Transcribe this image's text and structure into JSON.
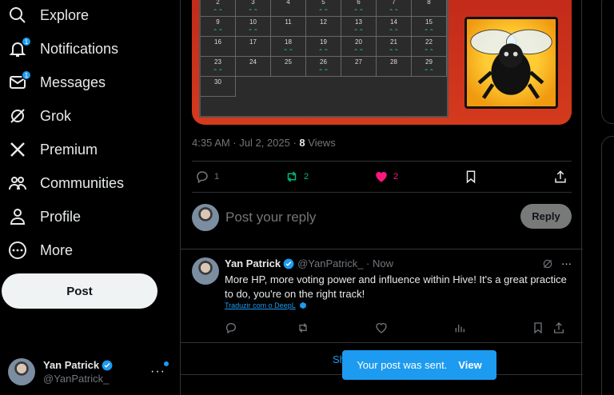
{
  "sidebar": {
    "items": [
      {
        "label": "Explore",
        "icon": "search-icon"
      },
      {
        "label": "Notifications",
        "icon": "bell-icon",
        "badge": "1"
      },
      {
        "label": "Messages",
        "icon": "envelope-icon",
        "badge": "1"
      },
      {
        "label": "Grok",
        "icon": "grok-icon"
      },
      {
        "label": "Premium",
        "icon": "x-logo-icon"
      },
      {
        "label": "Communities",
        "icon": "people-icon"
      },
      {
        "label": "Profile",
        "icon": "person-icon"
      },
      {
        "label": "More",
        "icon": "more-circle-icon"
      }
    ],
    "post_label": "Post",
    "account": {
      "name": "Yan Patrick",
      "handle": "@YanPatrick_"
    }
  },
  "tweet": {
    "time": "4:35 AM · Jul 2, 2025 · ",
    "views_count": "8",
    "views_label": " Views",
    "replies": "1",
    "reposts": "2",
    "likes": "2",
    "calendar_days": [
      {
        "n": "2",
        "up": true
      },
      {
        "n": "3",
        "up": true
      },
      {
        "n": "4",
        "up": false
      },
      {
        "n": "5",
        "up": true
      },
      {
        "n": "6",
        "up": true
      },
      {
        "n": "7",
        "up": true
      },
      {
        "n": "8",
        "up": false
      },
      {
        "n": "9",
        "up": true
      },
      {
        "n": "10",
        "up": true
      },
      {
        "n": "11",
        "up": false
      },
      {
        "n": "12",
        "up": false
      },
      {
        "n": "13",
        "up": true
      },
      {
        "n": "14",
        "up": true
      },
      {
        "n": "15",
        "up": true
      },
      {
        "n": "16",
        "up": false
      },
      {
        "n": "17",
        "up": false
      },
      {
        "n": "18",
        "up": true
      },
      {
        "n": "19",
        "up": true
      },
      {
        "n": "20",
        "up": true
      },
      {
        "n": "21",
        "up": true
      },
      {
        "n": "22",
        "up": true
      },
      {
        "n": "23",
        "up": true
      },
      {
        "n": "24",
        "up": false
      },
      {
        "n": "25",
        "up": false
      },
      {
        "n": "26",
        "up": true
      },
      {
        "n": "27",
        "up": false
      },
      {
        "n": "28",
        "up": false
      },
      {
        "n": "29",
        "up": true
      },
      {
        "n": "30",
        "up": false
      }
    ]
  },
  "reply_box": {
    "placeholder": "Post your reply",
    "button": "Reply"
  },
  "reply": {
    "name": "Yan Patrick",
    "handle": "@YanPatrick_ · Now",
    "text": "More HP, more voting power and influence within Hive! It's a great practice to do, you're on the right track!",
    "translate": "Traduzir com o DeepL"
  },
  "show_more": "Sh",
  "toast": {
    "message": "Your post was sent.",
    "action": "View"
  },
  "colors": {
    "accent": "#1d9bf0",
    "like": "#f91880",
    "repost": "#00ba7c"
  }
}
